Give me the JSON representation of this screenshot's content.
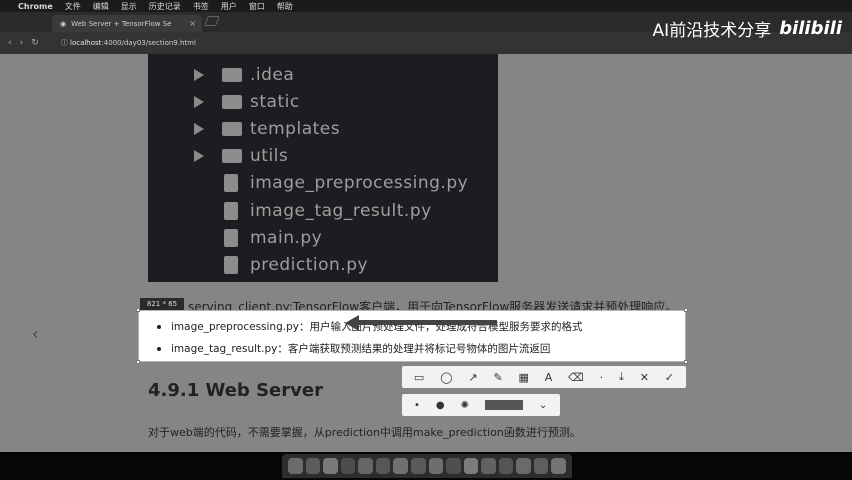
{
  "menubar": {
    "app_name": "Chrome",
    "items": [
      "文件",
      "编辑",
      "显示",
      "历史记录",
      "书签",
      "用户",
      "窗口",
      "帮助"
    ]
  },
  "browser": {
    "tab_title": "Web Server + TensorFlow Se",
    "url_host": "localhost",
    "url_path": ":4000/day03/section9.html"
  },
  "watermark": {
    "text": "AI前沿技术分享",
    "logo": "bilibili"
  },
  "code_tree": [
    {
      "type": "folder",
      "label": ".idea"
    },
    {
      "type": "folder",
      "label": "static"
    },
    {
      "type": "folder",
      "label": "templates"
    },
    {
      "type": "folder",
      "label": "utils"
    },
    {
      "type": "file",
      "label": "image_preprocessing.py"
    },
    {
      "type": "file",
      "label": "image_tag_result.py"
    },
    {
      "type": "file",
      "label": "main.py"
    },
    {
      "type": "file",
      "label": "prediction.py"
    }
  ],
  "capture": {
    "size_readout": "821 * 65"
  },
  "content": {
    "serving_line": "serving_client.py:TensorFlow客户端，用于向TensorFlow服务器发送请求并预处理响应。",
    "bullets": [
      "image_preprocessing.py：用户输入图片预处理文件，处理成符合模型服务要求的格式",
      "image_tag_result.py：客户端获取预测结果的处理并将标记号物体的图片流返回"
    ],
    "section_heading": "4.9.1 Web Server",
    "paragraph": "对于web端的代码，不需要掌握，从prediction中调用make_prediction函数进行预测。"
  },
  "toolbar": {
    "tools": [
      {
        "name": "rect-tool",
        "glyph": "▭"
      },
      {
        "name": "ellipse-tool",
        "glyph": "◯"
      },
      {
        "name": "arrow-tool",
        "glyph": "↗"
      },
      {
        "name": "pen-tool",
        "glyph": "✎"
      },
      {
        "name": "mosaic-tool",
        "glyph": "▦"
      },
      {
        "name": "text-tool",
        "glyph": "A"
      },
      {
        "name": "eraser-tool",
        "glyph": "⌫"
      },
      {
        "name": "more-tool",
        "glyph": "·"
      },
      {
        "name": "download-tool",
        "glyph": "⤓"
      },
      {
        "name": "cancel-tool",
        "glyph": "✕"
      },
      {
        "name": "confirm-tool",
        "glyph": "✓"
      }
    ],
    "size_options": [
      "•",
      "●",
      "✺"
    ],
    "color": "#555555"
  }
}
